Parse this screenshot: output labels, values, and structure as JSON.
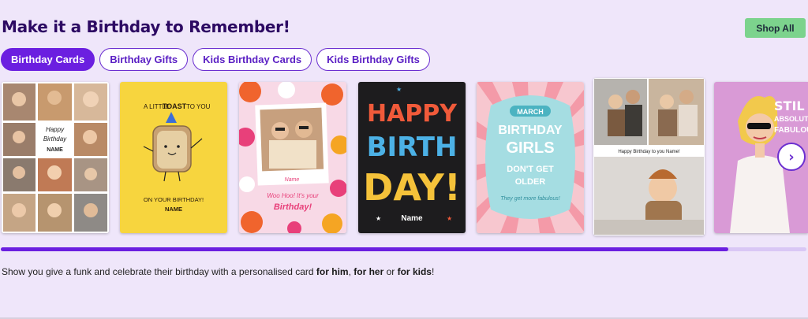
{
  "section": {
    "title": "Make it a Birthday to Remember!",
    "shop_all_label": "Shop All"
  },
  "tabs": [
    {
      "label": "Birthday Cards",
      "active": true
    },
    {
      "label": "Birthday Gifts",
      "active": false
    },
    {
      "label": "Kids Birthday Cards",
      "active": false
    },
    {
      "label": "Kids Birthday Gifts",
      "active": false
    }
  ],
  "cards": [
    {
      "name": "photo-collage-card",
      "text_lines": [
        "Happy",
        "Birthday",
        "NAME"
      ]
    },
    {
      "name": "toast-card",
      "text_top_1": "A LITTLE",
      "text_top_2": "TOAST",
      "text_top_3": "TO YOU",
      "text_bottom_1": "ON YOUR BIRTHDAY!",
      "text_bottom_2": "NAME"
    },
    {
      "name": "floral-polaroid-card",
      "photo_label": "Name",
      "text_1": "Woo Hoo! It's your",
      "text_2": "Birthday!"
    },
    {
      "name": "happy-birthday-letters-card",
      "line_1": "HAPPY",
      "line_2": "BIRTH",
      "line_3": "DAY!",
      "name_text": "Name"
    },
    {
      "name": "march-birthday-girls-card",
      "line_1": "MARCH",
      "line_2": "BIRTHDAY",
      "line_3": "GIRLS",
      "line_4": "DON'T GET",
      "line_5": "OLDER",
      "line_6": "They get more fabulous!"
    },
    {
      "name": "kids-photo-card",
      "caption": "Happy Birthday to you Name!"
    },
    {
      "name": "fabulous-card",
      "text_1": "STIL",
      "text_2": "ABSOLUTE",
      "text_3": "FABULOU"
    }
  ],
  "description": {
    "prefix": "Show you give a funk and celebrate their birthday with a personalised card ",
    "him": "for him",
    "comma": ", ",
    "her": "for her",
    "or": " or ",
    "kids": "for kids",
    "suffix": "!"
  },
  "scroll": {
    "progress": 0.903
  },
  "colors": {
    "accent": "#6b1fe0",
    "shop_all": "#7cd38d",
    "background": "#efe6fa"
  },
  "icons": {
    "next": "chevron-right-icon"
  },
  "next_glyph": "›"
}
